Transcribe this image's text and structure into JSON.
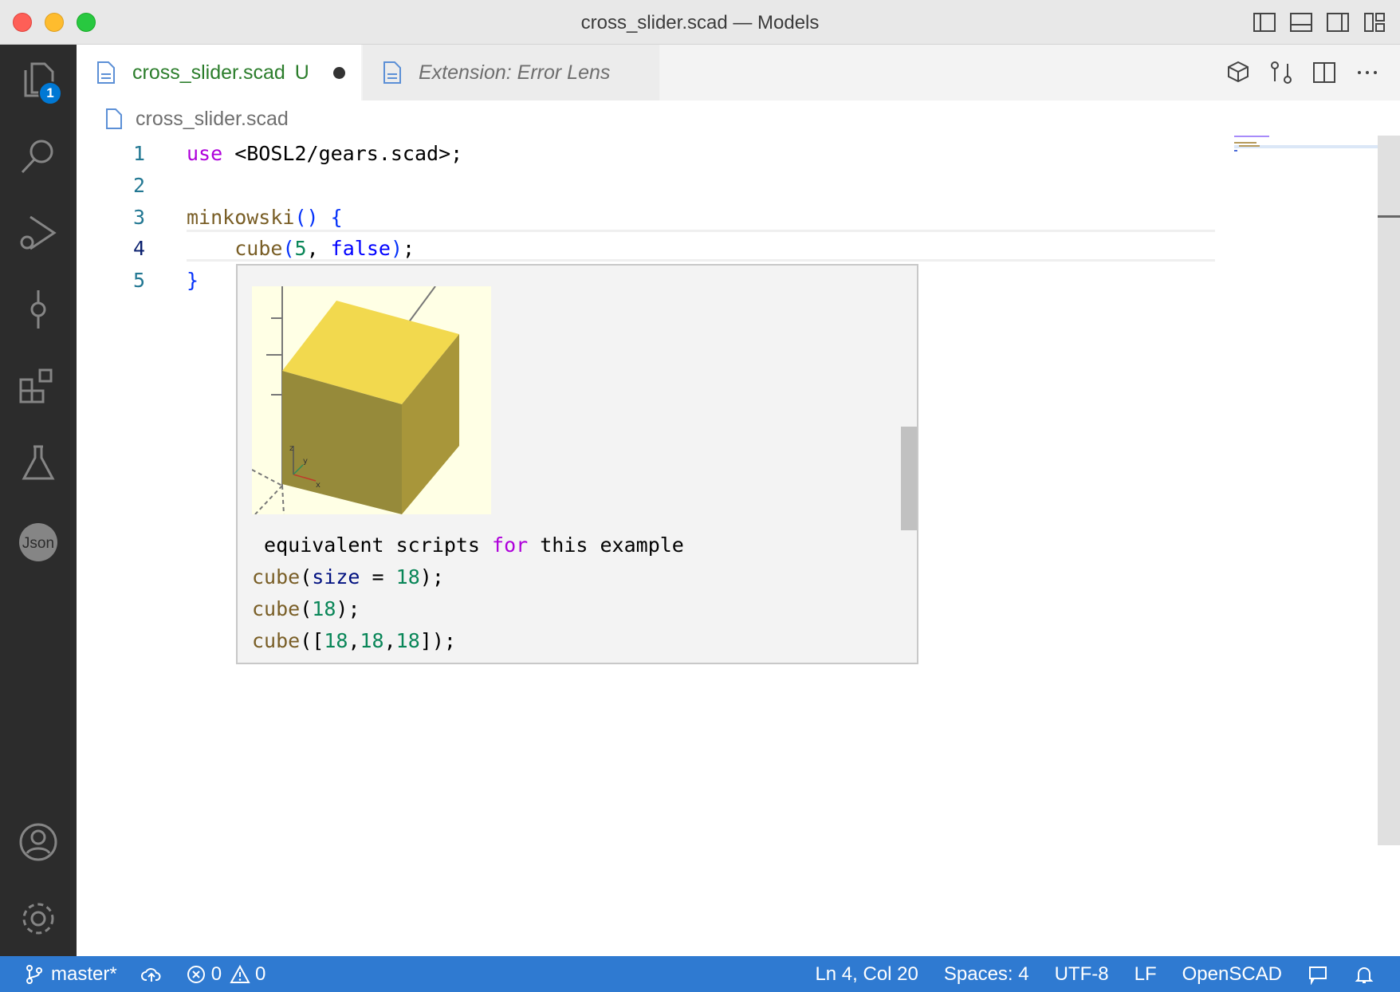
{
  "window": {
    "title": "cross_slider.scad — Models"
  },
  "activity_bar": {
    "explorer_badge": "1"
  },
  "tabs": [
    {
      "label": "cross_slider.scad",
      "status": "U"
    },
    {
      "label": "Extension: Error Lens"
    }
  ],
  "breadcrumb": {
    "file": "cross_slider.scad"
  },
  "editor": {
    "lines": [
      {
        "number": "1",
        "parts": [
          [
            "kw",
            "use"
          ],
          [
            "plain",
            " <BOSL2/gears.scad>;"
          ]
        ]
      },
      {
        "number": "2",
        "parts": []
      },
      {
        "number": "3",
        "parts": [
          [
            "fn",
            "minkowski"
          ],
          [
            "brace",
            "()"
          ],
          [
            "plain",
            " "
          ],
          [
            "brace",
            "{"
          ]
        ]
      },
      {
        "number": "4",
        "parts": [
          [
            "plain",
            "    "
          ],
          [
            "fn",
            "cube"
          ],
          [
            "brace",
            "("
          ],
          [
            "num",
            "5"
          ],
          [
            "plain",
            ", "
          ],
          [
            "bool",
            "false"
          ],
          [
            "brace",
            ")"
          ],
          [
            "plain",
            ";"
          ]
        ]
      },
      {
        "number": "5",
        "parts": [
          [
            "brace",
            "}"
          ]
        ]
      }
    ]
  },
  "hover": {
    "doc_lines": [
      [
        [
          "plain",
          " equivalent scripts "
        ],
        [
          "kw",
          "for"
        ],
        [
          "plain",
          " this example"
        ]
      ],
      [
        [
          "fn",
          "cube"
        ],
        [
          "plain",
          "("
        ],
        [
          "var",
          "size"
        ],
        [
          "plain",
          " = "
        ],
        [
          "num",
          "18"
        ],
        [
          "plain",
          ");"
        ]
      ],
      [
        [
          "fn",
          "cube"
        ],
        [
          "plain",
          "("
        ],
        [
          "num",
          "18"
        ],
        [
          "plain",
          ");"
        ]
      ],
      [
        [
          "fn",
          "cube"
        ],
        [
          "plain",
          "(["
        ],
        [
          "num",
          "18"
        ],
        [
          "plain",
          ","
        ],
        [
          "num",
          "18"
        ],
        [
          "plain",
          ","
        ],
        [
          "num",
          "18"
        ],
        [
          "plain",
          "]);"
        ]
      ]
    ],
    "image_axis_labels": {
      "x": "x",
      "y": "y",
      "z": "z"
    }
  },
  "statusbar": {
    "branch": "master*",
    "errors": "0",
    "warnings": "0",
    "position": "Ln 4, Col 20",
    "spaces": "Spaces: 4",
    "encoding": "UTF-8",
    "eol": "LF",
    "language": "OpenSCAD"
  },
  "colors": {
    "accent": "#2f7ad1",
    "activity_bg": "#2c2c2c",
    "modified_tab": "#2b7d2b",
    "cube_top": "#f2d94e",
    "cube_front": "#968a3a",
    "cube_side": "#a8963a"
  },
  "icons": {
    "activity": [
      "files-icon",
      "search-icon",
      "run-debug-icon",
      "source-control-icon",
      "extensions-icon",
      "testing-icon",
      "json-icon",
      "account-icon",
      "gear-icon"
    ],
    "titlebar": [
      "toggle-primary-sidebar-icon",
      "toggle-panel-icon",
      "toggle-secondary-sidebar-icon",
      "customize-layout-icon"
    ],
    "editor_actions": [
      "openscad-preview-icon",
      "compare-changes-icon",
      "split-editor-icon",
      "more-actions-icon"
    ]
  }
}
